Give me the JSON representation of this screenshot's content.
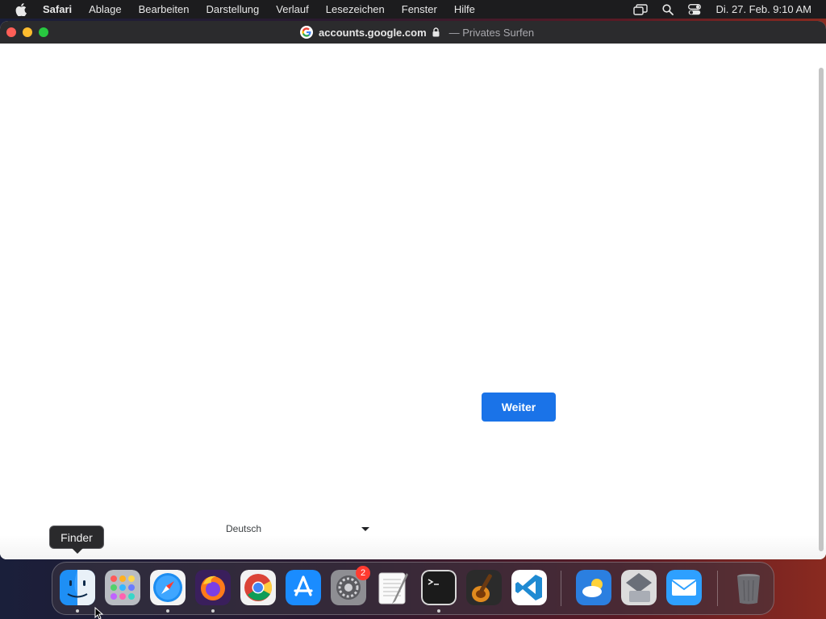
{
  "menubar": {
    "app_name": "Safari",
    "items": [
      "Ablage",
      "Bearbeiten",
      "Darstellung",
      "Verlauf",
      "Lesezeichen",
      "Fenster",
      "Hilfe"
    ],
    "clock": "Di. 27. Feb. 9:10 AM"
  },
  "browser": {
    "url": "accounts.google.com",
    "mode": "— Privates Surfen"
  },
  "page": {
    "next_button": "Weiter",
    "language_select": "Deutsch"
  },
  "dock": {
    "tooltip": "Finder",
    "system_settings_badge": "2"
  },
  "colors": {
    "google_blue": "#1a73e8",
    "close": "#ff5f57",
    "minimize": "#febc2e",
    "maximize": "#28c840"
  }
}
